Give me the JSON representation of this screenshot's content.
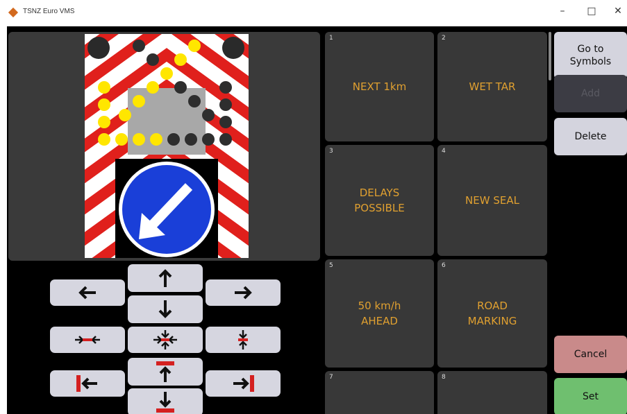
{
  "window": {
    "title": "TSNZ Euro VMS",
    "min": "–",
    "max": "□",
    "close": "✕"
  },
  "tiles": [
    {
      "num": "1",
      "lines": [
        "NEXT 1km"
      ]
    },
    {
      "num": "2",
      "lines": [
        "WET TAR"
      ]
    },
    {
      "num": "3",
      "lines": [
        "DELAYS",
        "POSSIBLE"
      ]
    },
    {
      "num": "4",
      "lines": [
        "NEW SEAL"
      ]
    },
    {
      "num": "5",
      "lines": [
        "50 km/h",
        "AHEAD"
      ]
    },
    {
      "num": "6",
      "lines": [
        "ROAD",
        "MARKING"
      ]
    },
    {
      "num": "7",
      "lines": []
    },
    {
      "num": "8",
      "lines": []
    }
  ],
  "buttons": {
    "go_to_symbols": "Go to\nSymbols",
    "add": "Add",
    "delete": "Delete",
    "cancel": "Cancel",
    "set": "Set"
  },
  "colors": {
    "accent_text": "#e0a030",
    "cancel": "#c98a8a",
    "set": "#6fbf6f",
    "sign_red": "#e0201c",
    "sign_blue": "#1a3fd8"
  }
}
